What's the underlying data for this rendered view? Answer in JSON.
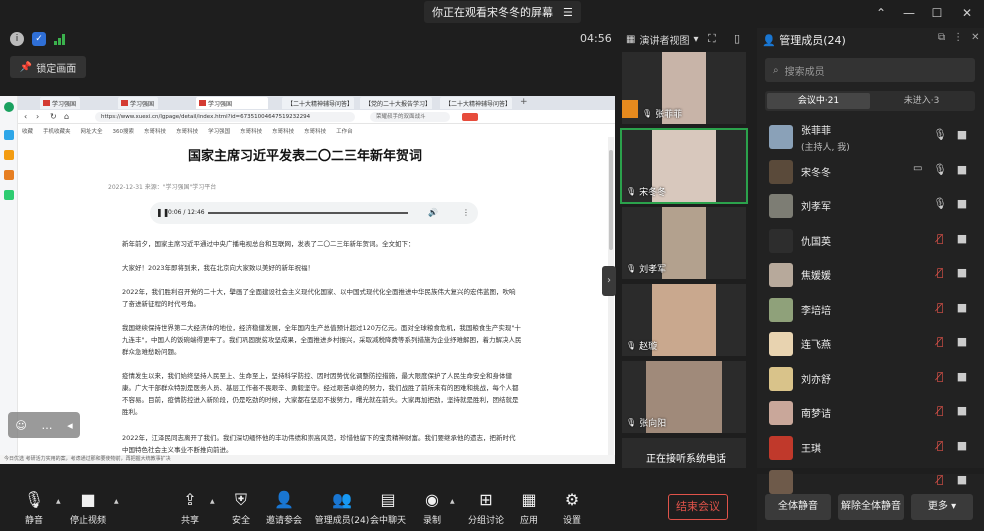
{
  "titlebar": {
    "share_banner": "你正在观看宋冬冬的屏幕",
    "minimize": "—",
    "maximize": "☐",
    "close": "✕",
    "pin": "⌃"
  },
  "status": {
    "time": "04:56"
  },
  "lock_button": "锁定画面",
  "browser": {
    "tabs": [
      "学习强国",
      "学习强国",
      "学习强国",
      "【二十大精神辅导问答】",
      "【党的二十大报告学习】",
      "【二十大精神辅导问答】"
    ],
    "url": "https://www.xuexi.cn/lgpage/detail/index.html?id=67351004647519232294",
    "search": "荣耀叔手的双面战斗",
    "bookmarks": [
      "收藏",
      "手机收藏夹",
      "网址大全",
      "360搜索",
      "东哥科技",
      "东哥科技",
      "学习强国",
      "东哥科技",
      "东哥科技",
      "东哥科技",
      "工作台"
    ],
    "status_text": "今日优选   考研活力实用的案，考虑通过那和要使物前，再把握大统教事扩决"
  },
  "article": {
    "title": "国家主席习近平发表二〇二三年新年贺词",
    "meta": "2022-12-31    来源：\"学习强国\"学习平台",
    "audio_time": "0:06 / 12:46",
    "paragraphs": [
      "新年前夕，国家主席习近平通过中央广播电视总台和互联网，发表了二〇二三年新年贺词。全文如下：",
      "大家好！2023年即将到来，我在北京向大家致以美好的新年祝福！",
      "2022年，我们胜利召开党的二十大，擘画了全面建设社会主义现代化国家、以中国式现代化全面推进中华民族伟大复兴的宏伟蓝图，吹响了奋进新征程的时代号角。",
      "我国继续保持世界第二大经济体的地位，经济稳健发展，全年国内生产总值预计超过120万亿元。面对全球粮食危机，我国粮食生产实现\"十九连丰\"，中国人的饭碗端得更牢了。我们巩固脱贫攻坚成果，全面推进乡村振兴，采取减税降费等系列措施为企业纾难解困，着力解决人民群众急难愁盼问题。",
      "疫情发生以来，我们始终坚持人民至上、生命至上，坚持科学防控、因时因势优化调整防控措施，最大限度保护了人民生命安全和身体健康。广大干部群众特别是医务人员、基层工作者不畏艰辛、勇毅坚守。经过艰苦卓绝的努力，我们战胜了前所未有的困难和挑战，每个人都不容易。目前，疫情防控进入新阶段，仍是吃劲的时候，大家都在坚忍不拔努力，曙光就在前头。大家再加把劲，坚持就是胜利，团结就是胜利。",
      "2022年，江泽民同志离开了我们。我们深切缅怀他的丰功伟绩和崇高风范，珍惜他留下的宝贵精神财富。我们要继承他的遗志，把新时代中国特色社会主义事业不断推向前进。"
    ]
  },
  "video_panel": {
    "view_mode": "演讲者视图",
    "tiles": [
      {
        "name": "张菲菲",
        "speaking": false
      },
      {
        "name": "宋冬冬",
        "speaking": true
      },
      {
        "name": "刘孝军",
        "speaking": false
      },
      {
        "name": "赵璇",
        "speaking": false
      },
      {
        "name": "张向阳",
        "speaking": false
      },
      {
        "name": "正在接听系统电话",
        "speaking": false
      }
    ]
  },
  "members": {
    "title": "管理成员(24)",
    "search_placeholder": "搜索成员",
    "tab_in": "会议中·21",
    "tab_out": "未进入·3",
    "list": [
      {
        "name": "张菲菲",
        "sub": "(主持人, 我)",
        "mic": "on",
        "cam": "on",
        "screen": false,
        "color": "#8aa1b8"
      },
      {
        "name": "宋冬冬",
        "sub": "",
        "mic": "on",
        "cam": "on",
        "screen": true,
        "color": "#5a4a3a"
      },
      {
        "name": "刘孝军",
        "sub": "",
        "mic": "on",
        "cam": "on",
        "screen": false,
        "color": "#7d7d74"
      },
      {
        "name": "仇国英",
        "sub": "",
        "mic": "off",
        "cam": "on",
        "screen": false,
        "color": "#2d2d2d"
      },
      {
        "name": "焦媛媛",
        "sub": "",
        "mic": "off",
        "cam": "on",
        "screen": false,
        "color": "#b7a99b"
      },
      {
        "name": "李培培",
        "sub": "",
        "mic": "off",
        "cam": "on",
        "screen": false,
        "color": "#8fa17a"
      },
      {
        "name": "连飞燕",
        "sub": "",
        "mic": "off",
        "cam": "on",
        "screen": false,
        "color": "#e8d3b0"
      },
      {
        "name": "刘亦舒",
        "sub": "",
        "mic": "off",
        "cam": "on",
        "screen": false,
        "color": "#d9c38a"
      },
      {
        "name": "南梦诘",
        "sub": "",
        "mic": "off",
        "cam": "on",
        "screen": false,
        "color": "#c9a79a"
      },
      {
        "name": "王琪",
        "sub": "",
        "mic": "off",
        "cam": "on",
        "screen": false,
        "color": "#c0392b"
      },
      {
        "name": "",
        "sub": "",
        "mic": "off",
        "cam": "on",
        "screen": false,
        "color": "#6e5a4a"
      }
    ]
  },
  "toolbar": {
    "mute": "静音",
    "stop_video": "停止视频",
    "share": "共享",
    "security": "安全",
    "invite": "邀请参会",
    "manage": "管理成员(24)",
    "chat": "会中聊天",
    "record": "录制",
    "breakout": "分组讨论",
    "apps": "应用",
    "settings": "设置",
    "end": "结束会议"
  },
  "panel_footer": {
    "mute_all": "全体静音",
    "unmute_all": "解除全体静音",
    "more": "更多 ▾"
  }
}
